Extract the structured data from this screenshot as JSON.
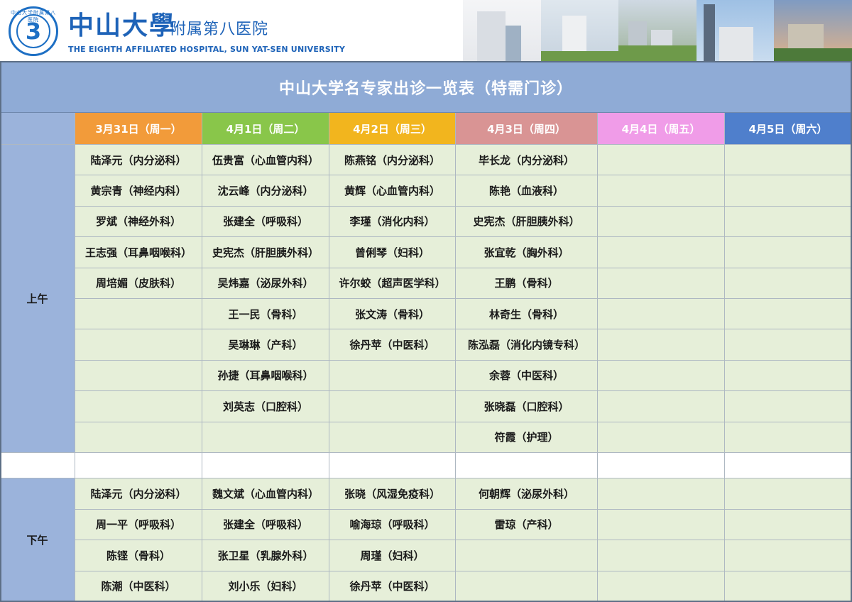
{
  "header": {
    "logo_mark": "3",
    "logo_ring_text": "中山大学附属第八医院",
    "brand_main": "中山大學",
    "brand_sub": "附属第八医院",
    "brand_en": "THE EIGHTH AFFILIATED HOSPITAL, SUN YAT-SEN UNIVERSITY"
  },
  "title": "中山大学名专家出诊一览表（特需门诊）",
  "days": [
    {
      "label": "3月31日（周一）",
      "color": "#f29b3a"
    },
    {
      "label": "4月1日（周二）",
      "color": "#89c64a"
    },
    {
      "label": "4月2日（周三）",
      "color": "#f2b51e"
    },
    {
      "label": "4月3日（周四）",
      "color": "#d99494"
    },
    {
      "label": "4月4日（周五）",
      "color": "#f09ce8"
    },
    {
      "label": "4月5日（周六）",
      "color": "#4f7fcc"
    }
  ],
  "sessions": {
    "morning": "上午",
    "afternoon": "下午"
  },
  "morning": [
    [
      "陆泽元（内分泌科）",
      "伍贵富（心血管内科）",
      "陈燕铭（内分泌科）",
      "毕长龙（内分泌科）",
      "",
      ""
    ],
    [
      "黄宗青（神经内科）",
      "沈云峰（内分泌科）",
      "黄辉（心血管内科）",
      "陈艳（血液科）",
      "",
      ""
    ],
    [
      "罗斌（神经外科）",
      "张建全（呼吸科）",
      "李瑾（消化内科）",
      "史宪杰（肝胆胰外科）",
      "",
      ""
    ],
    [
      "王志强（耳鼻咽喉科）",
      "史宪杰（肝胆胰外科）",
      "曾俐琴（妇科）",
      "张宜乾（胸外科）",
      "",
      ""
    ],
    [
      "周培媚（皮肤科）",
      "吴炜嘉（泌尿外科）",
      "许尔蛟（超声医学科）",
      "王鹏（骨科）",
      "",
      ""
    ],
    [
      "",
      "王一民（骨科）",
      "张文涛（骨科）",
      "林奇生（骨科）",
      "",
      ""
    ],
    [
      "",
      "吴琳琳（产科）",
      "徐丹苹（中医科）",
      "陈泓磊（消化内镜专科）",
      "",
      ""
    ],
    [
      "",
      "孙捷（耳鼻咽喉科）",
      "",
      "余蓉（中医科）",
      "",
      ""
    ],
    [
      "",
      "刘英志（口腔科）",
      "",
      "张晓磊（口腔科）",
      "",
      ""
    ],
    [
      "",
      "",
      "",
      "符霞（护理）",
      "",
      ""
    ]
  ],
  "afternoon": [
    [
      "陆泽元（内分泌科）",
      "魏文斌（心血管内科）",
      "张晓（风湿免疫科）",
      "何朝辉（泌尿外科）",
      "",
      ""
    ],
    [
      "周一平（呼吸科）",
      "张建全（呼吸科）",
      "喻海琼（呼吸科）",
      "雷琼（产科）",
      "",
      ""
    ],
    [
      "陈铿（骨科）",
      "张卫星（乳腺外科）",
      "周瑾（妇科）",
      "",
      "",
      ""
    ],
    [
      "陈潮（中医科）",
      "刘小乐（妇科）",
      "徐丹苹（中医科）",
      "",
      "",
      ""
    ]
  ]
}
